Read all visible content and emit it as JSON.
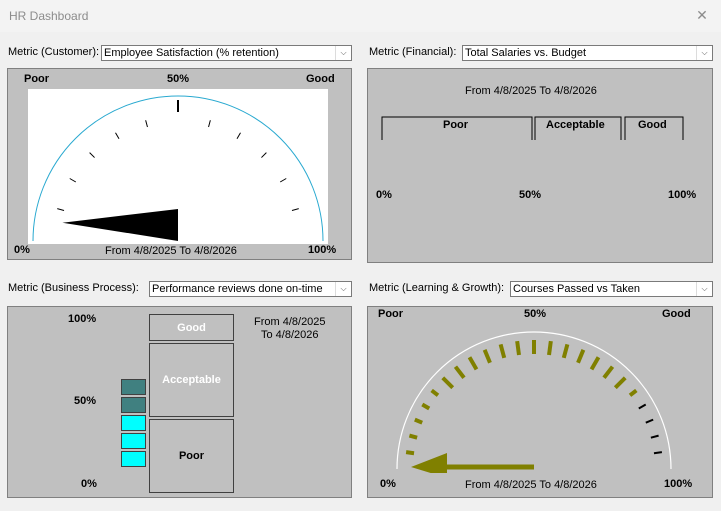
{
  "window": {
    "title": "HR Dashboard",
    "close_icon": "close-icon"
  },
  "customer": {
    "label": "Metric (Customer):",
    "selected": "Employee Satisfaction (% retention)",
    "poor": "Poor",
    "mid": "50%",
    "good": "Good",
    "min": "0%",
    "max": "100%",
    "range": "From 4/8/2025 To 4/8/2026",
    "needle_fraction": 0.05
  },
  "financial": {
    "label": "Metric (Financial):",
    "selected": "Total Salaries vs. Budget",
    "range": "From 4/8/2025 To 4/8/2026",
    "poor": "Poor",
    "acceptable": "Acceptable",
    "good": "Good",
    "min": "0%",
    "mid": "50%",
    "max": "100%"
  },
  "business": {
    "label": "Metric (Business Process):",
    "selected": "Performance reviews done on-time",
    "max": "100%",
    "mid": "50%",
    "min": "0%",
    "good": "Good",
    "acceptable": "Acceptable",
    "poor": "Poor",
    "range_from": "From 4/8/2025",
    "range_to": "To 4/8/2026",
    "value_fraction": 0.55,
    "colors": {
      "good": "#008000",
      "acceptable": "#408080",
      "poor": "#00ffff"
    }
  },
  "learning": {
    "label": "Metric (Learning & Growth):",
    "selected": "Courses Passed vs Taken",
    "poor": "Poor",
    "mid": "50%",
    "good": "Good",
    "min": "0%",
    "max": "100%",
    "range": "From 4/8/2025 To 4/8/2026",
    "needle_fraction": 0.0,
    "colors": {
      "ticks": "#808000"
    }
  }
}
